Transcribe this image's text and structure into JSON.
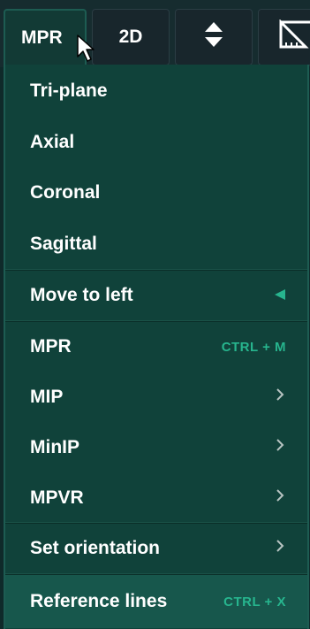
{
  "toolbar": {
    "mpr_label": "MPR",
    "twod_label": "2D",
    "arrows_icon": "up-down-arrows-icon",
    "ruler_icon": "ruler-icon"
  },
  "menu": {
    "items": [
      {
        "label": "Tri-plane"
      },
      {
        "label": "Axial"
      },
      {
        "label": "Coronal"
      },
      {
        "label": "Sagittal"
      },
      {
        "label": "Move to left",
        "icon": "triangle-left-icon"
      },
      {
        "label": "MPR",
        "shortcut": "CTRL + M"
      },
      {
        "label": "MIP",
        "icon": "chevron-right-icon"
      },
      {
        "label": "MinIP",
        "icon": "chevron-right-icon"
      },
      {
        "label": "MPVR",
        "icon": "chevron-right-icon"
      },
      {
        "label": "Set orientation",
        "icon": "chevron-right-icon"
      },
      {
        "label": "Reference lines",
        "shortcut": "CTRL + X",
        "highlighted": true
      }
    ]
  },
  "colors": {
    "menu_bg": "#10423a",
    "highlight_bg": "#17574c",
    "accent": "#27b58e",
    "toolbar_bg": "#162c2f"
  }
}
